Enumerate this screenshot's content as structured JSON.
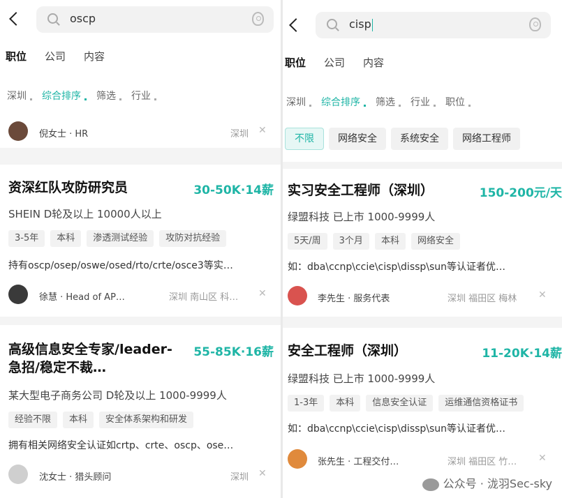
{
  "left": {
    "search_query": "oscp",
    "tabs": [
      {
        "label": "职位",
        "active": true
      },
      {
        "label": "公司",
        "active": false
      },
      {
        "label": "内容",
        "active": false
      }
    ],
    "filters": [
      {
        "label": "深圳",
        "active": false
      },
      {
        "label": "综合排序",
        "active": true
      },
      {
        "label": "筛选",
        "active": false
      },
      {
        "label": "行业",
        "active": false
      }
    ],
    "hr_row": {
      "name": "倪女士 · HR",
      "location": "深圳"
    },
    "jobs": [
      {
        "title": "资深红队攻防研究员",
        "salary": "30-50K·14薪",
        "company": "SHEIN  D轮及以上  10000人以上",
        "tags": [
          "3-5年",
          "本科",
          "渗透测试经验",
          "攻防对抗经验"
        ],
        "desc": "持有oscp/osep/oswe/osed/rto/crte/osce3等实…",
        "recruiter": "徐慧 · Head of AP…",
        "location": "深圳  南山区  科…"
      },
      {
        "title": "高级信息安全专家/leader-急招/稳定不裁…",
        "salary": "55-85K·16薪",
        "company": "某大型电子商务公司  D轮及以上  1000-9999人",
        "tags": [
          "经验不限",
          "本科",
          "安全体系架构和研发"
        ],
        "desc": "拥有相关网络安全认证如crtp、crte、oscp、ose…",
        "recruiter": "沈女士 · 猎头顾问",
        "location": "深圳"
      }
    ]
  },
  "right": {
    "search_query": "cisp",
    "tabs": [
      {
        "label": "职位",
        "active": true
      },
      {
        "label": "公司",
        "active": false
      },
      {
        "label": "内容",
        "active": false
      }
    ],
    "filters": [
      {
        "label": "深圳",
        "active": false
      },
      {
        "label": "综合排序",
        "active": true
      },
      {
        "label": "筛选",
        "active": false
      },
      {
        "label": "行业",
        "active": false
      },
      {
        "label": "职位",
        "active": false
      }
    ],
    "chips": [
      {
        "label": "不限",
        "selected": true
      },
      {
        "label": "网络安全",
        "selected": false
      },
      {
        "label": "系统安全",
        "selected": false
      },
      {
        "label": "网络工程师",
        "selected": false
      }
    ],
    "jobs": [
      {
        "title": "实习安全工程师（深圳）",
        "salary": "150-200元/天",
        "company": "绿盟科技  已上市  1000-9999人",
        "tags": [
          "5天/周",
          "3个月",
          "本科",
          "网络安全"
        ],
        "desc": "如：dba\\ccnp\\ccie\\cisp\\dissp\\sun等认证者优…",
        "recruiter": "李先生 · 服务代表",
        "location": "深圳  福田区  梅林"
      },
      {
        "title": "安全工程师（深圳）",
        "salary": "11-20K·14薪",
        "company": "绿盟科技  已上市  1000-9999人",
        "tags": [
          "1-3年",
          "本科",
          "信息安全认证",
          "运维通信资格证书"
        ],
        "desc": "如：dba\\ccnp\\ccie\\cisp\\dissp\\sun等认证者优…",
        "recruiter": "张先生 · 工程交付…",
        "location": "深圳  福田区  竹…"
      }
    ]
  },
  "watermark": "公众号 · 泷羽Sec-sky",
  "colors": {
    "accent": "#1fb5a6"
  }
}
